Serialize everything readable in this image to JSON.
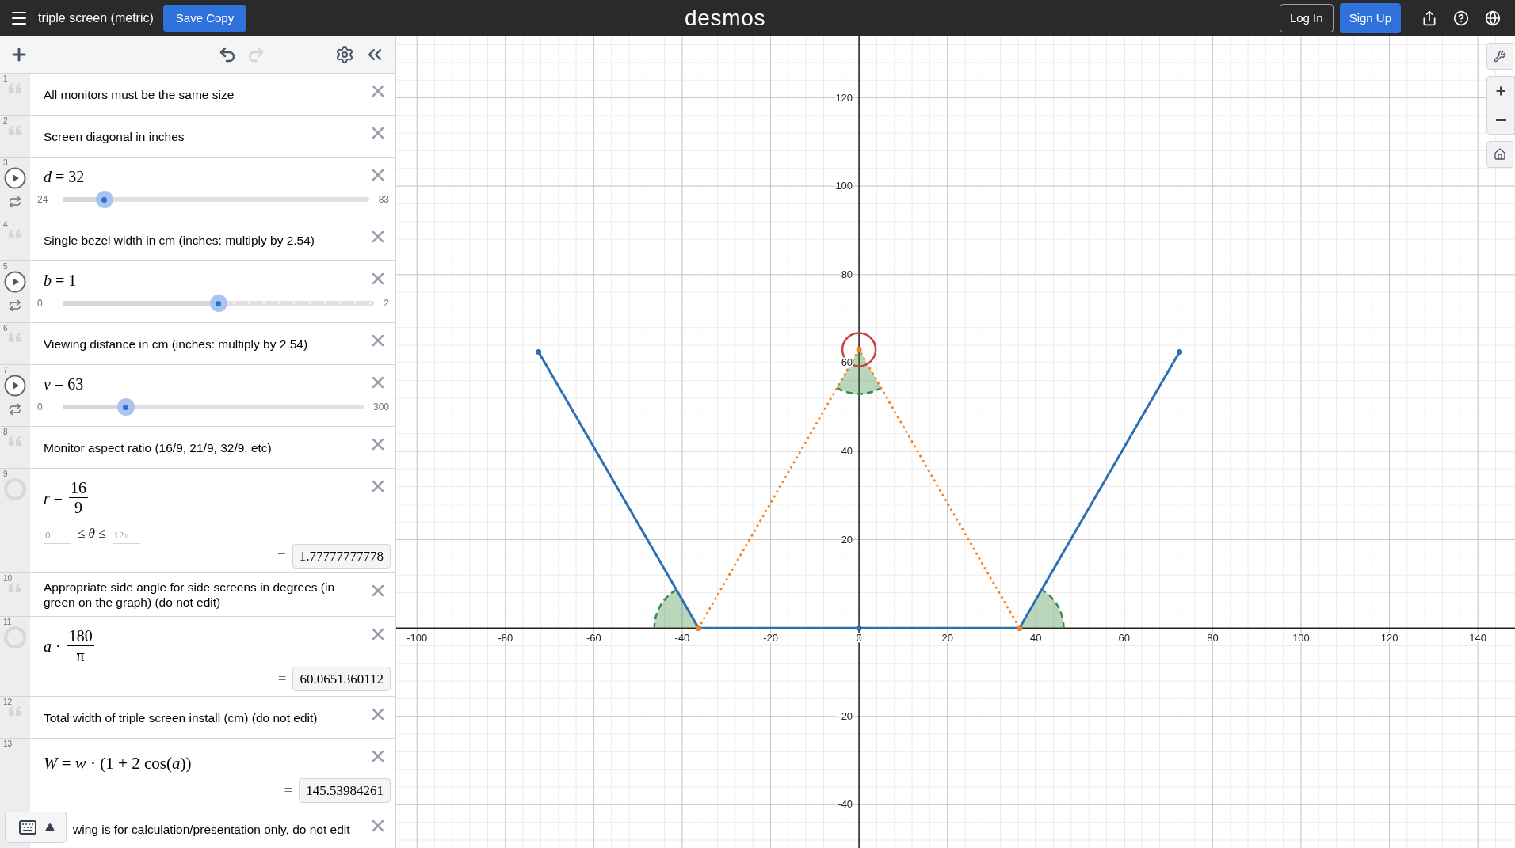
{
  "header": {
    "title": "triple screen (metric)",
    "save_button": "Save Copy",
    "logo": "desmos",
    "login_button": "Log In",
    "signup_button": "Sign Up"
  },
  "toolbar": {
    "undo": {
      "disabled": false
    },
    "redo": {
      "disabled": true
    }
  },
  "expressions": [
    {
      "number": "1",
      "kind": "note",
      "text": "All monitors must be the same size"
    },
    {
      "number": "2",
      "kind": "note",
      "text": "Screen diagonal in inches"
    },
    {
      "number": "3",
      "kind": "slider",
      "expression": "*d* = 32",
      "min": "24",
      "max": "83",
      "level": 0.136,
      "steps": false
    },
    {
      "number": "4",
      "kind": "note",
      "text": "Single bezel width in cm (inches: multiply by 2.54)"
    },
    {
      "number": "5",
      "kind": "slider",
      "expression": "*b* = 1",
      "min": "0",
      "max": "2",
      "level": 0.5,
      "steps": true
    },
    {
      "number": "6",
      "kind": "note",
      "text": "Viewing distance in cm (inches: multiply by 2.54)"
    },
    {
      "number": "7",
      "kind": "slider",
      "expression": "*v* = 63",
      "min": "0",
      "max": "300",
      "level": 0.21,
      "steps": false
    },
    {
      "number": "8",
      "kind": "note",
      "text": "Monitor aspect ratio (16/9, 21/9, 32/9, etc)"
    },
    {
      "number": "9",
      "kind": "fraction",
      "lhs": "*r* =",
      "numerator": "16",
      "denominator": "9",
      "domain": {
        "min": "0",
        "lower_relation": "≤",
        "variable": "θ",
        "upper_relation": "≤",
        "max": "12π"
      },
      "result_sign": "=",
      "result": "1.77777777778"
    },
    {
      "number": "10",
      "kind": "note",
      "text": "Appropriate side angle for side screens in degrees (in green on the graph) (do not edit)"
    },
    {
      "number": "11",
      "kind": "fraction",
      "lhs": "*a* ·",
      "numerator": "180",
      "denominator": "π",
      "result_sign": "=",
      "result": "60.0651360112"
    },
    {
      "number": "12",
      "kind": "note",
      "text": "Total width of triple screen install (cm) (do not edit)"
    },
    {
      "number": "13",
      "kind": "expression",
      "expression": "*W* = *w* · (1 + 2 cos(*a*))",
      "result_sign": "=",
      "result": "145.53984261"
    },
    {
      "kind": "cut_note",
      "text": "wing is for calculation/presentation only, do not edit"
    }
  ],
  "graph": {
    "chart_data": {
      "type": "line",
      "x": [
        -72.5,
        -36.3,
        0,
        36.3,
        72.5
      ],
      "series": [
        {
          "color": "#2d70b3",
          "line_style": "solid",
          "marker": "circle",
          "values": [
            62.5,
            0,
            0,
            0,
            62.5
          ]
        },
        {
          "color": "#fa7e19",
          "line_style": "dotted",
          "marker": "circle",
          "values": [
            null,
            0,
            63,
            0,
            null
          ]
        }
      ],
      "grid": true,
      "xlim": [
        -104.7,
        148.4
      ],
      "ylim": [
        -49.8,
        133.9
      ],
      "xticks": [
        -100,
        -80,
        -60,
        -40,
        -20,
        0,
        20,
        40,
        60,
        80,
        100,
        120,
        140
      ],
      "yticks": [
        -40,
        -20,
        20,
        40,
        60,
        80,
        100,
        120
      ]
    }
  }
}
